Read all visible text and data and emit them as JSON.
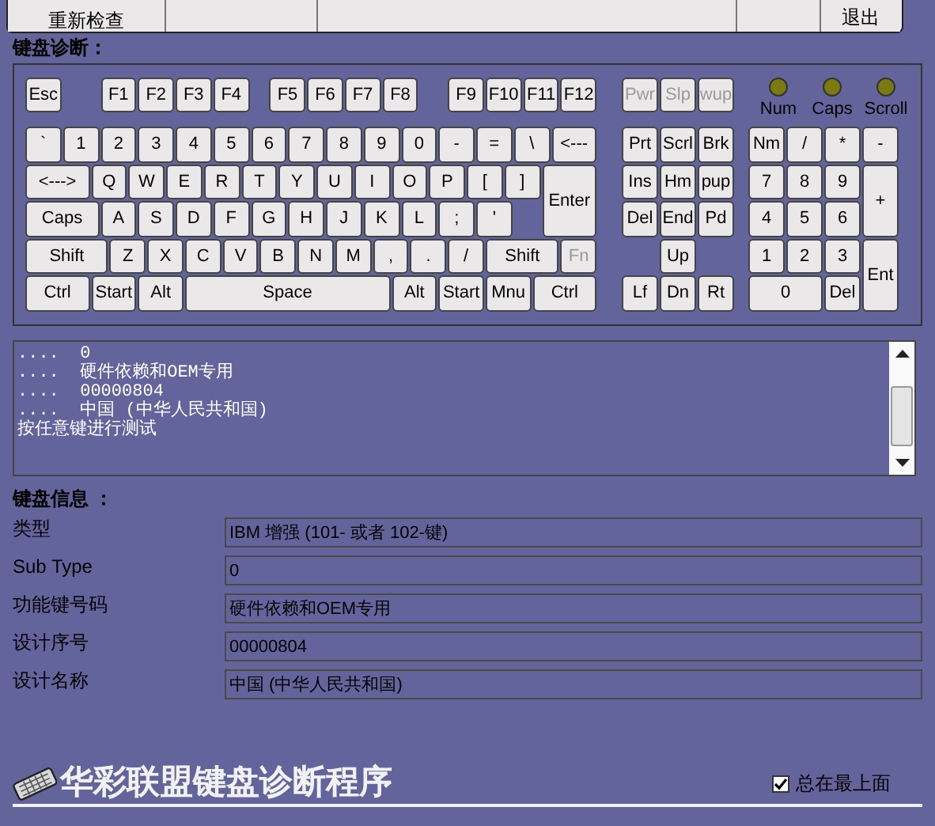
{
  "toolbar": {
    "recheck_button": "重新检查",
    "exit_button": "退出"
  },
  "diagnosis": {
    "heading": "键盘诊断：",
    "function_row": [
      {
        "label": "Esc",
        "disabled": false
      },
      {
        "label": "F1",
        "disabled": false
      },
      {
        "label": "F2",
        "disabled": false
      },
      {
        "label": "F3",
        "disabled": false
      },
      {
        "label": "F4",
        "disabled": false
      },
      {
        "label": "F5",
        "disabled": false
      },
      {
        "label": "F6",
        "disabled": false
      },
      {
        "label": "F7",
        "disabled": false
      },
      {
        "label": "F8",
        "disabled": false
      },
      {
        "label": "F9",
        "disabled": false
      },
      {
        "label": "F10",
        "disabled": false
      },
      {
        "label": "F11",
        "disabled": false
      },
      {
        "label": "F12",
        "disabled": false
      }
    ],
    "main_rows": [
      [
        {
          "label": "`",
          "disabled": false
        },
        {
          "label": "1",
          "disabled": false
        },
        {
          "label": "2",
          "disabled": false
        },
        {
          "label": "3",
          "disabled": false
        },
        {
          "label": "4",
          "disabled": false
        },
        {
          "label": "5",
          "disabled": false
        },
        {
          "label": "6",
          "disabled": false
        },
        {
          "label": "7",
          "disabled": false
        },
        {
          "label": "8",
          "disabled": false
        },
        {
          "label": "9",
          "disabled": false
        },
        {
          "label": "0",
          "disabled": false
        },
        {
          "label": "-",
          "disabled": false
        },
        {
          "label": "=",
          "disabled": false
        },
        {
          "label": "\\",
          "disabled": false
        },
        {
          "label": "<---",
          "disabled": false
        }
      ],
      [
        {
          "label": "<--->",
          "disabled": false
        },
        {
          "label": "Q",
          "disabled": false
        },
        {
          "label": "W",
          "disabled": false
        },
        {
          "label": "E",
          "disabled": false
        },
        {
          "label": "R",
          "disabled": false
        },
        {
          "label": "T",
          "disabled": false
        },
        {
          "label": "Y",
          "disabled": false
        },
        {
          "label": "U",
          "disabled": false
        },
        {
          "label": "I",
          "disabled": false
        },
        {
          "label": "O",
          "disabled": false
        },
        {
          "label": "P",
          "disabled": false
        },
        {
          "label": "[",
          "disabled": false
        },
        {
          "label": "]",
          "disabled": false
        },
        {
          "label": "Enter",
          "disabled": false
        }
      ],
      [
        {
          "label": "Caps",
          "disabled": false
        },
        {
          "label": "A",
          "disabled": false
        },
        {
          "label": "S",
          "disabled": false
        },
        {
          "label": "D",
          "disabled": false
        },
        {
          "label": "F",
          "disabled": false
        },
        {
          "label": "G",
          "disabled": false
        },
        {
          "label": "H",
          "disabled": false
        },
        {
          "label": "J",
          "disabled": false
        },
        {
          "label": "K",
          "disabled": false
        },
        {
          "label": "L",
          "disabled": false
        },
        {
          "label": ";",
          "disabled": false
        },
        {
          "label": "'",
          "disabled": false
        }
      ],
      [
        {
          "label": "Shift",
          "disabled": false
        },
        {
          "label": "Z",
          "disabled": false
        },
        {
          "label": "X",
          "disabled": false
        },
        {
          "label": "C",
          "disabled": false
        },
        {
          "label": "V",
          "disabled": false
        },
        {
          "label": "B",
          "disabled": false
        },
        {
          "label": "N",
          "disabled": false
        },
        {
          "label": "M",
          "disabled": false
        },
        {
          "label": ",",
          "disabled": false
        },
        {
          "label": ".",
          "disabled": false
        },
        {
          "label": "/",
          "disabled": false
        },
        {
          "label": "Shift",
          "disabled": false
        },
        {
          "label": "Fn",
          "disabled": true
        }
      ],
      [
        {
          "label": "Ctrl",
          "disabled": false
        },
        {
          "label": "Start",
          "disabled": false
        },
        {
          "label": "Alt",
          "disabled": false
        },
        {
          "label": "Space",
          "disabled": false
        },
        {
          "label": "Alt",
          "disabled": false
        },
        {
          "label": "Start",
          "disabled": false
        },
        {
          "label": "Mnu",
          "disabled": false
        },
        {
          "label": "Ctrl",
          "disabled": false
        }
      ]
    ],
    "power_row": [
      {
        "label": "Pwr",
        "disabled": true
      },
      {
        "label": "Slp",
        "disabled": true
      },
      {
        "label": "wup",
        "disabled": true
      }
    ],
    "nav_rows": [
      [
        {
          "label": "Prt",
          "disabled": false
        },
        {
          "label": "Scrl",
          "disabled": false
        },
        {
          "label": "Brk",
          "disabled": false
        }
      ],
      [
        {
          "label": "Ins",
          "disabled": false
        },
        {
          "label": "Hm",
          "disabled": false
        },
        {
          "label": "pup",
          "disabled": false
        }
      ],
      [
        {
          "label": "Del",
          "disabled": false
        },
        {
          "label": "End",
          "disabled": false
        },
        {
          "label": "Pd",
          "disabled": false
        }
      ],
      [
        {
          "label": "Up",
          "disabled": false
        }
      ],
      [
        {
          "label": "Lf",
          "disabled": false
        },
        {
          "label": "Dn",
          "disabled": false
        },
        {
          "label": "Rt",
          "disabled": false
        }
      ]
    ],
    "indicators": [
      {
        "label": "Num",
        "on": false
      },
      {
        "label": "Caps",
        "on": false
      },
      {
        "label": "Scroll",
        "on": false
      }
    ],
    "numpad_rows": [
      [
        {
          "label": "Nm",
          "disabled": false
        },
        {
          "label": "/",
          "disabled": false
        },
        {
          "label": "*",
          "disabled": false
        },
        {
          "label": "-",
          "disabled": false
        }
      ],
      [
        {
          "label": "7",
          "disabled": false
        },
        {
          "label": "8",
          "disabled": false
        },
        {
          "label": "9",
          "disabled": false
        },
        {
          "label": "+",
          "disabled": false
        }
      ],
      [
        {
          "label": "4",
          "disabled": false
        },
        {
          "label": "5",
          "disabled": false
        },
        {
          "label": "6",
          "disabled": false
        }
      ],
      [
        {
          "label": "1",
          "disabled": false
        },
        {
          "label": "2",
          "disabled": false
        },
        {
          "label": "3",
          "disabled": false
        },
        {
          "label": "Ent",
          "disabled": false
        }
      ],
      [
        {
          "label": "0",
          "disabled": false
        },
        {
          "label": "Del",
          "disabled": false
        }
      ]
    ]
  },
  "log": {
    "lines": [
      "....  0",
      "....  硬件依赖和OEM专用",
      "....  00000804",
      "....  中国 (中华人民共和国)",
      "按任意键进行测试"
    ]
  },
  "info": {
    "heading": "键盘信息 ：",
    "rows": [
      {
        "label": "类型",
        "value": "IBM 增强 (101- 或者 102-键)"
      },
      {
        "label": "Sub Type",
        "value": "0"
      },
      {
        "label": "功能键号码",
        "value": "硬件依赖和OEM专用"
      },
      {
        "label": "设计序号",
        "value": "00000804"
      },
      {
        "label": "设计名称",
        "value": "中国 (中华人民共和国)"
      }
    ]
  },
  "footer": {
    "title": "华彩联盟键盘诊断程序",
    "always_on_top": {
      "label": "总在最上面",
      "checked": true
    }
  }
}
